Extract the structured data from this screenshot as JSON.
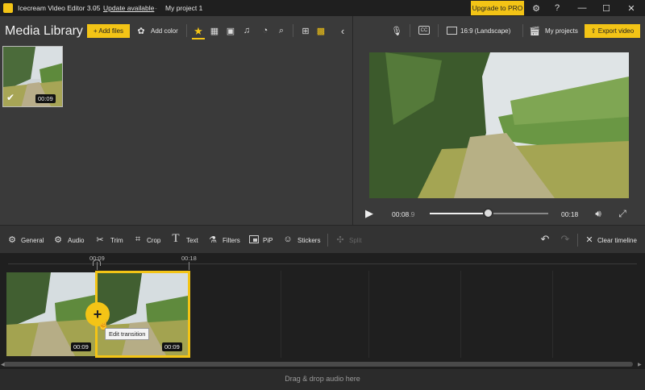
{
  "titlebar": {
    "app": "Icecream Video Editor 3.05",
    "update": "Update available",
    "project": "My project 1",
    "pro": "Upgrade to PRO"
  },
  "media": {
    "title": "Media Library",
    "add_files": "+ Add files",
    "add_color": "Add color",
    "item_duration": "00:09"
  },
  "top_right": {
    "ratio": "16:9 (Landscape)",
    "my_projects": "My projects",
    "export": "Export video"
  },
  "player": {
    "current": "00:08",
    "current_frac": ".9",
    "total": "00:18",
    "progress": 0.49
  },
  "tools": {
    "general": "General",
    "audio": "Audio",
    "trim": "Trim",
    "crop": "Crop",
    "text": "Text",
    "filters": "Filters",
    "pip": "PiP",
    "stickers": "Stickers",
    "split": "Split",
    "clear": "Clear timeline"
  },
  "timeline": {
    "mark1": "00:09",
    "mark2": "00:18",
    "clip1_dur": "00:09",
    "clip2_dur": "00:09",
    "tooltip": "Edit transition",
    "drop": "Drag & drop audio here"
  },
  "colors": {
    "accent": "#f3c416"
  }
}
